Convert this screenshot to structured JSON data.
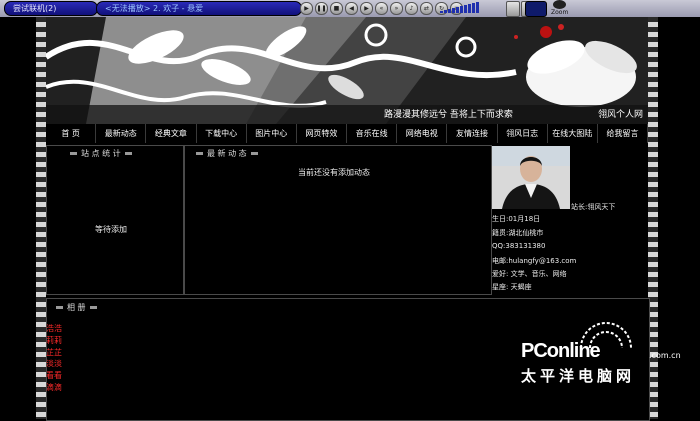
{
  "player": {
    "tab1": "尝试联机(2)",
    "tab2": "<无法播放> 2. 欢子 - 悬爱",
    "logo": "Zoom"
  },
  "banner": {
    "caption": "路漫漫其修远兮 吾将上下而求索",
    "site": "翎风个人网"
  },
  "nav": [
    "首 页",
    "最新动态",
    "经典文章",
    "下载中心",
    "图片中心",
    "网页特效",
    "音乐在线",
    "网络电视",
    "友情连接",
    "翎风日志",
    "在线大图陆",
    "给我留言"
  ],
  "stats": {
    "title": "站 点 统 计",
    "body": "等待添加"
  },
  "news": {
    "title": "最 新 动 态",
    "body": "当前还没有添加动态"
  },
  "profile": {
    "owner": "站长:翎风天下",
    "birthday": "生日:01月18日",
    "origin": "籍贯:湖北仙桃市",
    "qq": "QQ:383131380",
    "email": "电邮:hulangfy@163.com",
    "hobby": "爱好: 文学、音乐、网络",
    "sign": "星座: 天蝎座"
  },
  "album": {
    "title": "相 册",
    "links": [
      "浩浩",
      "莉莉",
      "芷芷",
      "淡淡",
      "看看",
      "滴滴"
    ]
  },
  "watermark": {
    "main": "PConline",
    "com": ".com.cn",
    "cn": "太平洋电脑网"
  }
}
